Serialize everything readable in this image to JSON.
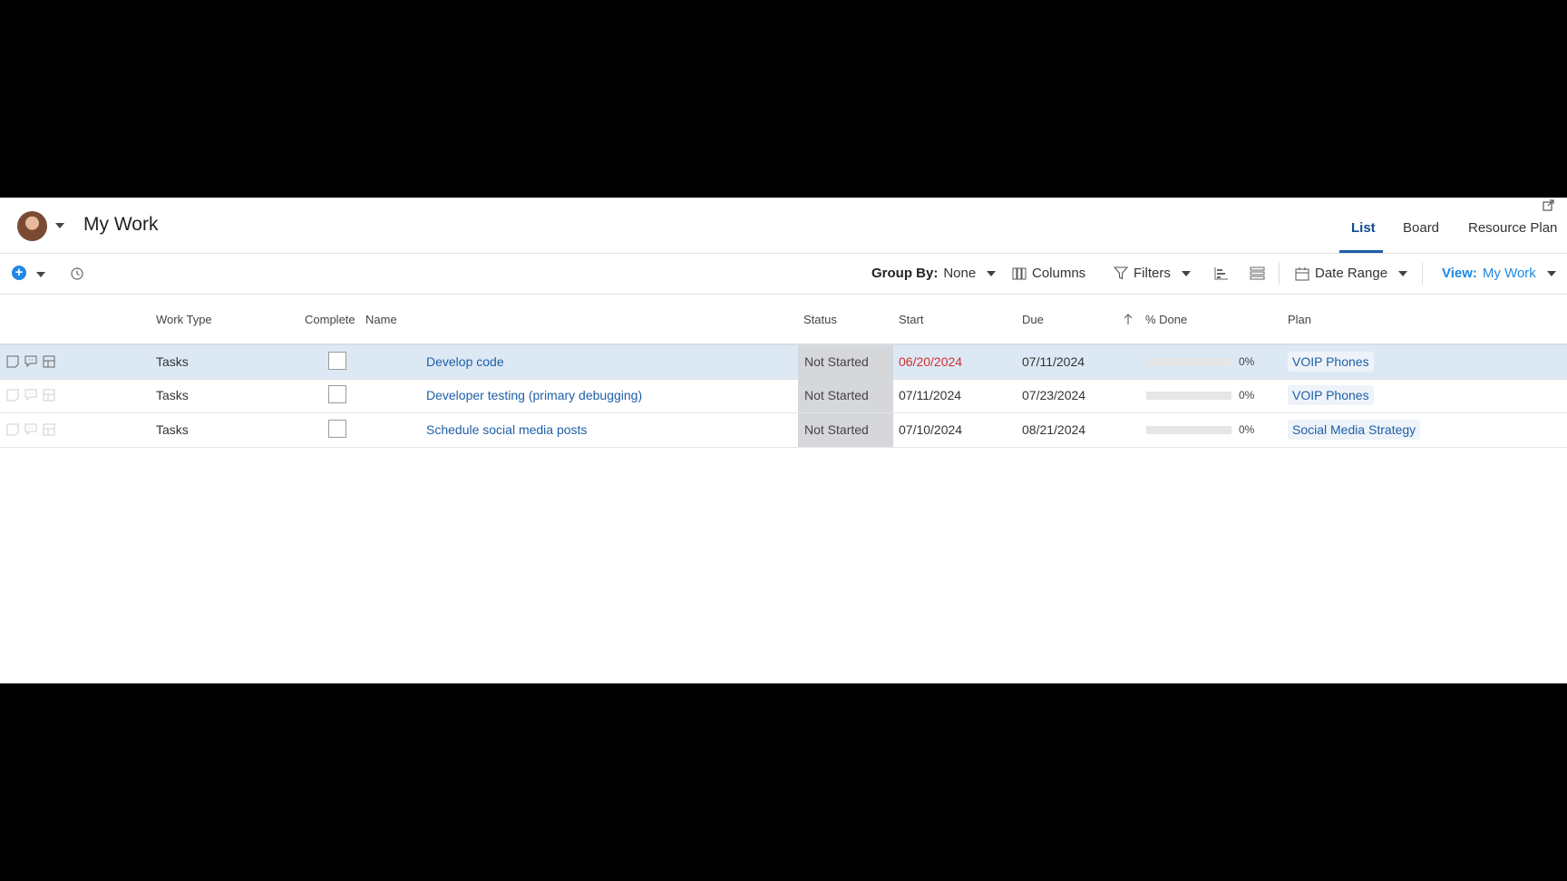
{
  "header": {
    "title": "My Work",
    "tabs": [
      {
        "label": "List",
        "active": true
      },
      {
        "label": "Board",
        "active": false
      },
      {
        "label": "Resource Plan",
        "active": false
      }
    ]
  },
  "toolbar": {
    "group_by_label": "Group By:",
    "group_by_value": "None",
    "columns_label": "Columns",
    "filters_label": "Filters",
    "date_range_label": "Date Range",
    "view_label": "View:",
    "view_value": "My Work"
  },
  "table": {
    "columns": [
      "Work Type",
      "Complete",
      "Name",
      "Status",
      "Start",
      "Due",
      "% Done",
      "Plan"
    ],
    "rows": [
      {
        "work_type": "Tasks",
        "complete": false,
        "name": "Develop code",
        "status": "Not Started",
        "start": "06/20/2024",
        "start_overdue": true,
        "due": "07/11/2024",
        "pct_done": "0%",
        "progress": 0,
        "plan": "VOIP Phones",
        "selected": true
      },
      {
        "work_type": "Tasks",
        "complete": false,
        "name": "Developer testing (primary debugging)",
        "status": "Not Started",
        "start": "07/11/2024",
        "start_overdue": false,
        "due": "07/23/2024",
        "pct_done": "0%",
        "progress": 0,
        "plan": "VOIP Phones",
        "selected": false
      },
      {
        "work_type": "Tasks",
        "complete": false,
        "name": "Schedule social media posts",
        "status": "Not Started",
        "start": "07/10/2024",
        "start_overdue": false,
        "due": "08/21/2024",
        "pct_done": "0%",
        "progress": 0,
        "plan": "Social Media Strategy",
        "selected": false
      }
    ]
  },
  "colors": {
    "accent": "#1e88e5",
    "link": "#1e5fa8",
    "overdue": "#d32f2f",
    "selected_row": "#dce9f5",
    "status_bg": "#d5d7da"
  },
  "icons": [
    "avatar",
    "chevron-down-icon",
    "popout-icon",
    "plus-icon",
    "clock-icon",
    "columns-icon",
    "filter-icon",
    "gantt-icon",
    "list-density-icon",
    "calendar-icon",
    "sort-up-icon",
    "note-icon",
    "comment-icon",
    "details-icon"
  ]
}
